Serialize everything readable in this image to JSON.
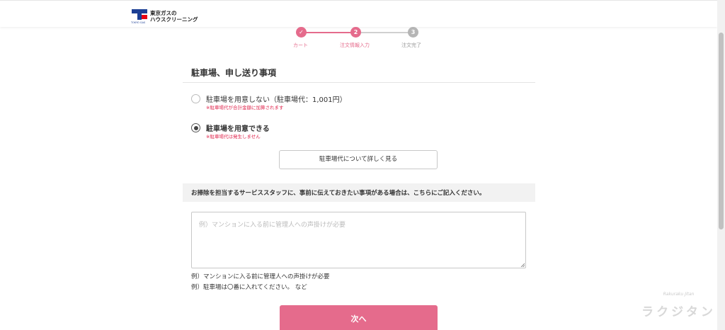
{
  "header": {
    "logo_line1": "東京ガスの",
    "logo_line2": "ハウスクリーニング",
    "logo_sub": "TOKYO GAS"
  },
  "steps": [
    {
      "number": "✓",
      "label": "カート",
      "state": "done"
    },
    {
      "number": "2",
      "label": "注文情報入力",
      "state": "current"
    },
    {
      "number": "3",
      "label": "注文完了",
      "state": "pending"
    }
  ],
  "parking": {
    "title": "駐車場、申し送り事項",
    "options": [
      {
        "label": "駐車場を用意しない（駐車場代：1,001円）",
        "note": "※駐車場代が合計金額に加算されます",
        "selected": false
      },
      {
        "label": "駐車場を用意できる",
        "note": "※駐車場代は発生しません",
        "selected": true
      }
    ],
    "detail_button": "駐車場代について詳しく見る"
  },
  "notes": {
    "notice": "お掃除を担当するサービススタッフに、事前に伝えておきたい事項がある場合は、こちらにご記入ください。",
    "placeholder": "例）マンションに入る前に管理人への声掛けが必要",
    "value": "",
    "example1": "例）マンションに入る前に管理人への声掛けが必要",
    "example2": "例）駐車場は〇番に入れてください。 など"
  },
  "next_button": "次へ",
  "watermark": {
    "top": "Rakuraku Jitan",
    "main": "ラクジタン"
  },
  "colors": {
    "accent": "#e56b8c",
    "note_red": "#e0284f",
    "pending": "#b5b5b5",
    "brand_blue": "#1c3f94"
  }
}
